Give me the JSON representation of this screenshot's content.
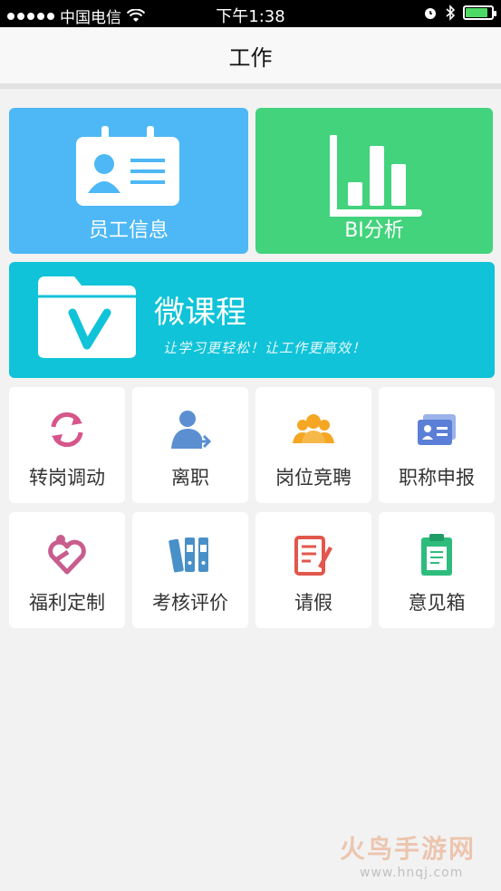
{
  "status_bar": {
    "carrier": "中国电信",
    "time": "下午1:38",
    "battery_level": 0.8
  },
  "nav": {
    "title": "工作"
  },
  "tiles": {
    "employee_info": "员工信息",
    "bi_analysis": "BI分析",
    "micro_course": {
      "title": "微课程",
      "subtitle": "让学习更轻松！让工作更高效！"
    }
  },
  "grid": [
    {
      "label": "转岗调动",
      "icon": "rotate-arrows-icon",
      "color": "#d6568a"
    },
    {
      "label": "离职",
      "icon": "person-exit-icon",
      "color": "#5b8fd1"
    },
    {
      "label": "岗位竞聘",
      "icon": "group-people-icon",
      "color": "#f5a623"
    },
    {
      "label": "职称申报",
      "icon": "id-card-icon",
      "color": "#5b7fd6"
    },
    {
      "label": "福利定制",
      "icon": "heart-hand-icon",
      "color": "#c85d8e"
    },
    {
      "label": "考核评价",
      "icon": "binders-icon",
      "color": "#4a90c8"
    },
    {
      "label": "请假",
      "icon": "notepad-pen-icon",
      "color": "#e2574c"
    },
    {
      "label": "意见箱",
      "icon": "clipboard-icon",
      "color": "#2ebc7d"
    }
  ],
  "watermark": {
    "line1": "火鸟手游网",
    "line2": "www.hnqj.com"
  }
}
